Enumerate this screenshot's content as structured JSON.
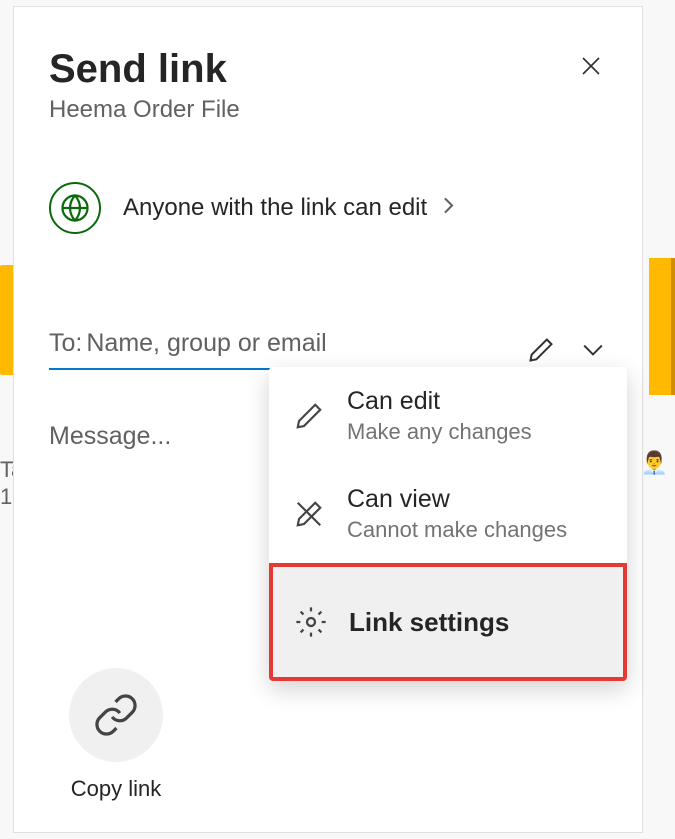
{
  "dialog": {
    "title": "Send link",
    "subtitle": "Heema Order File"
  },
  "permission": {
    "text": "Anyone with the link can edit"
  },
  "to": {
    "label": "To:",
    "placeholder": "Name, group or email"
  },
  "message": {
    "placeholder": "Message..."
  },
  "dropdown": {
    "items": [
      {
        "title": "Can edit",
        "subtitle": "Make any changes"
      },
      {
        "title": "Can view",
        "subtitle": "Cannot make changes"
      },
      {
        "title": "Link settings"
      }
    ]
  },
  "copyLink": {
    "label": "Copy link"
  },
  "background": {
    "line1": "Ta",
    "line2": "1",
    "num": "1"
  }
}
